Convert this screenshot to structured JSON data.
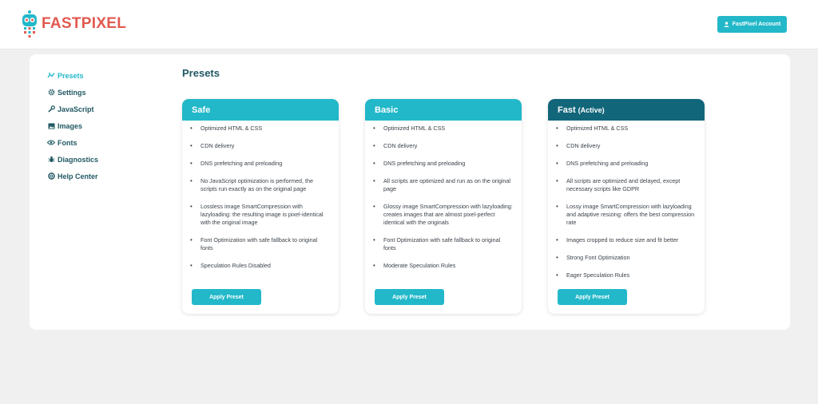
{
  "brand": {
    "part1": "FAST",
    "part2": "PIXEL"
  },
  "header": {
    "account_label": "FastPixel Account"
  },
  "sidebar": {
    "items": [
      {
        "label": "Presets",
        "icon": "presets-icon",
        "active": true
      },
      {
        "label": "Settings",
        "icon": "gear-icon"
      },
      {
        "label": "JavaScript",
        "icon": "wrench-icon"
      },
      {
        "label": "Images",
        "icon": "image-icon"
      },
      {
        "label": "Fonts",
        "icon": "eye-icon"
      },
      {
        "label": "Diagnostics",
        "icon": "bug-icon"
      },
      {
        "label": "Help Center",
        "icon": "help-icon"
      }
    ]
  },
  "main": {
    "title": "Presets",
    "apply_label": "Apply Preset",
    "cards": [
      {
        "title": "Safe",
        "tag": "",
        "features": [
          "Optimized HTML & CSS",
          "CDN delivery",
          "DNS prefetching and preloading",
          "No JavaScript optimization is performed, the scripts run exactly as on the original page",
          "Lossless image SmartCompression with lazyloading: the resulting image is pixel-identical with the original image",
          "Font Optimization with safe fallback to original fonts",
          "Speculation Rules Disabled"
        ]
      },
      {
        "title": "Basic",
        "tag": "",
        "features": [
          "Optimized HTML & CSS",
          "CDN delivery",
          "DNS prefetching and preloading",
          "All scripts are optimized and run as on the original page",
          "Glossy image SmartCompression with lazyloading: creates images that are almost pixel-perfect identical with the originals",
          "Font Optimization with safe fallback to original fonts",
          "Moderate Speculation Rules"
        ]
      },
      {
        "title": "Fast",
        "tag": "(Active)",
        "features": [
          "Optimized HTML & CSS",
          "CDN delivery",
          "DNS prefetching and preloading",
          "All scripts are optimized and delayed, except necessary scripts like GDPR",
          "Lossy image SmartCompression with lazyloading and adaptive resizing: offers the best compression rate",
          "Images cropped to reduce size and fit better",
          "Strong Font Optimization",
          "Eager Speculation Rules"
        ]
      }
    ]
  },
  "colors": {
    "accent": "#22b8c9",
    "active_header": "#12667a",
    "nav_text": "#215963",
    "logo": "#e1594f"
  }
}
